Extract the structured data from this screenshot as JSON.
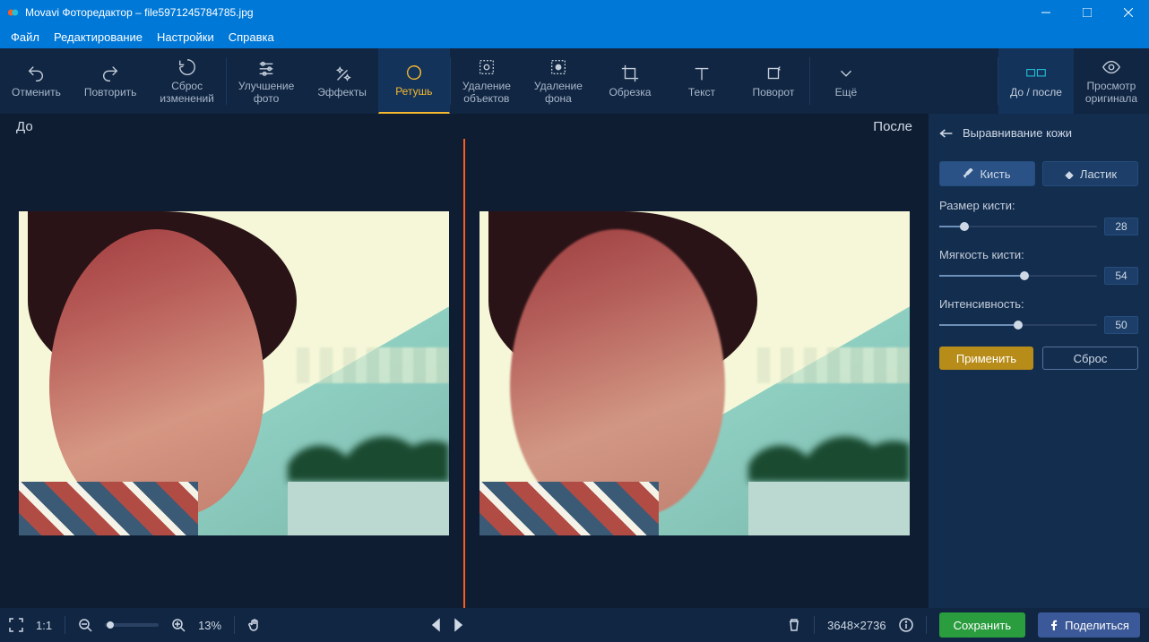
{
  "window": {
    "title": "Movavi Фоторедактор – file5971245784785.jpg"
  },
  "menu": {
    "file": "Файл",
    "edit": "Редактирование",
    "settings": "Настройки",
    "help": "Справка"
  },
  "toolbar": {
    "undo": "Отменить",
    "redo": "Повторить",
    "reset_changes": "Сброс\nизменений",
    "enhance": "Улучшение\nфото",
    "effects": "Эффекты",
    "retouch": "Ретушь",
    "remove_objects": "Удаление\nобъектов",
    "remove_bg": "Удаление\nфона",
    "crop": "Обрезка",
    "text": "Текст",
    "rotate": "Поворот",
    "more": "Ещё",
    "before_after": "До / после",
    "view_original": "Просмотр\nоригинала"
  },
  "canvas": {
    "before_label": "До",
    "after_label": "После"
  },
  "panel": {
    "title": "Выравнивание кожи",
    "brush": "Кисть",
    "eraser": "Ластик",
    "brush_size_label": "Размер кисти:",
    "brush_size_value": "28",
    "brush_soft_label": "Мягкость кисти:",
    "brush_soft_value": "54",
    "intensity_label": "Интенсивность:",
    "intensity_value": "50",
    "apply": "Применить",
    "reset": "Сброс"
  },
  "bottom": {
    "fit_label": "1:1",
    "zoom_pct": "13%",
    "dimensions": "3648×2736",
    "save": "Сохранить",
    "share": "Поделиться"
  }
}
